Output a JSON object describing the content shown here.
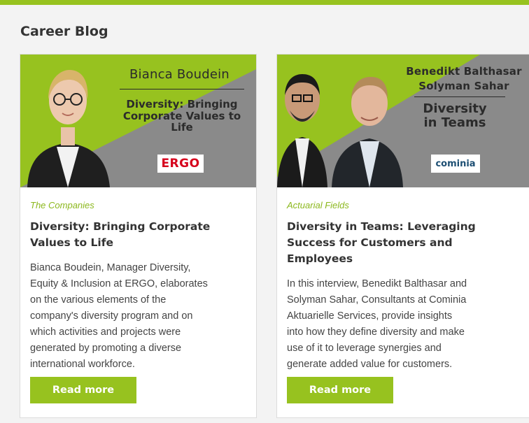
{
  "section": {
    "title": "Career Blog"
  },
  "cards": [
    {
      "hero_name": "Bianca Boudein",
      "hero_headline_lines": [
        "Diversity: Bringing",
        "Corporate Values to",
        "Life"
      ],
      "logo_text": "ERGO",
      "category": "The Companies",
      "title_lines": [
        "Diversity: Bringing Corporate",
        "Values to Life"
      ],
      "text_lines": [
        "Bianca Boudein, Manager Diversity,",
        "Equity & Inclusion at ERGO, elaborates",
        "on the various elements of the",
        "company's diversity program and on",
        "which activities and projects were",
        "generated by promoting a diverse",
        "international workforce."
      ],
      "button_label": "Read more"
    },
    {
      "hero_name_lines": [
        "Benedikt Balthasar",
        "Solyman Sahar"
      ],
      "hero_headline_lines": [
        "Diversity",
        "in Teams"
      ],
      "logo_text": "cominia",
      "category": "Actuarial Fields",
      "title_lines": [
        "Diversity in Teams: Leveraging",
        "Success for Customers and",
        "Employees"
      ],
      "text_lines": [
        "In this interview, Benedikt Balthasar and",
        "Solyman Sahar, Consultants at Cominia",
        "Aktuarielle Services, provide insights",
        "into how they define diversity and make",
        "use of it to leverage synergies and",
        "generate added value for customers."
      ],
      "button_label": "Read more"
    }
  ],
  "colors": {
    "accent": "#97c21f",
    "category": "#8cb81d",
    "hero_gray": "#8a8a8a",
    "ergo_red": "#d6001c",
    "cominia_blue": "#1d4f73"
  }
}
